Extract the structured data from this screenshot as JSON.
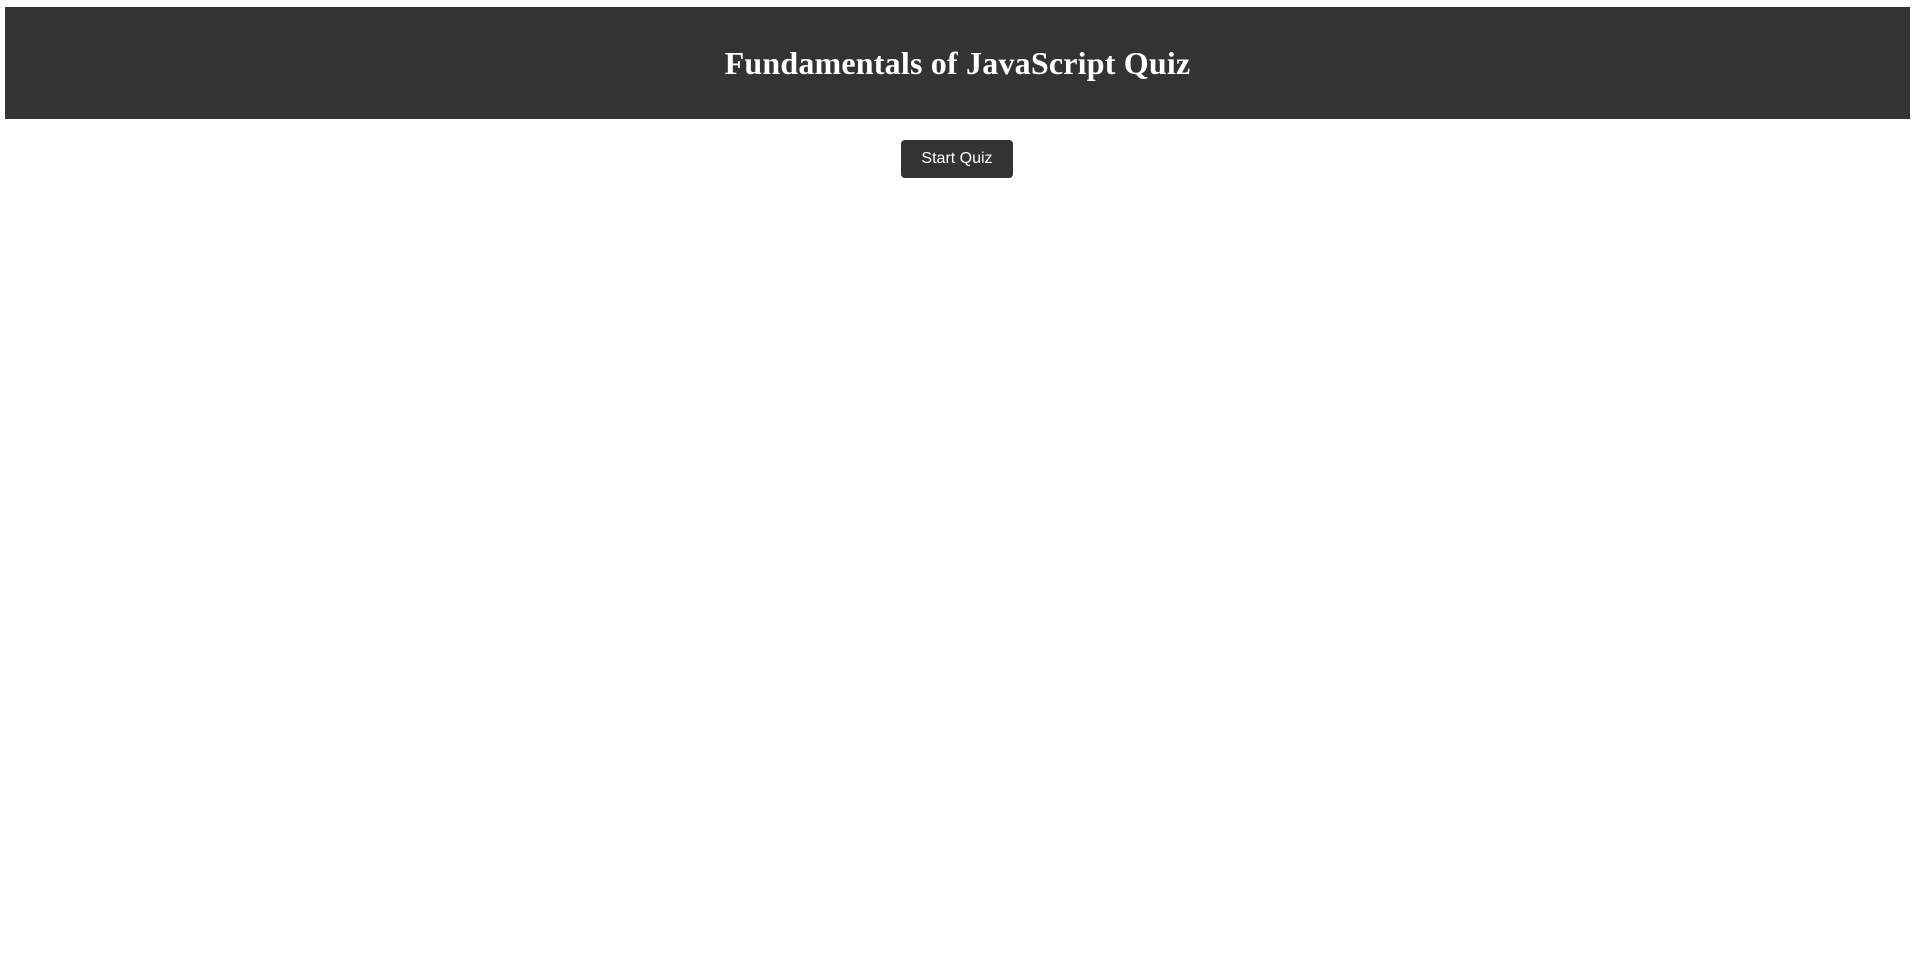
{
  "header": {
    "title": "Fundamentals of JavaScript Quiz"
  },
  "main": {
    "start_button_label": "Start Quiz"
  },
  "colors": {
    "header_bg": "#333333",
    "button_bg": "#333333",
    "text_on_dark": "#ffffff",
    "page_bg": "#ffffff"
  }
}
